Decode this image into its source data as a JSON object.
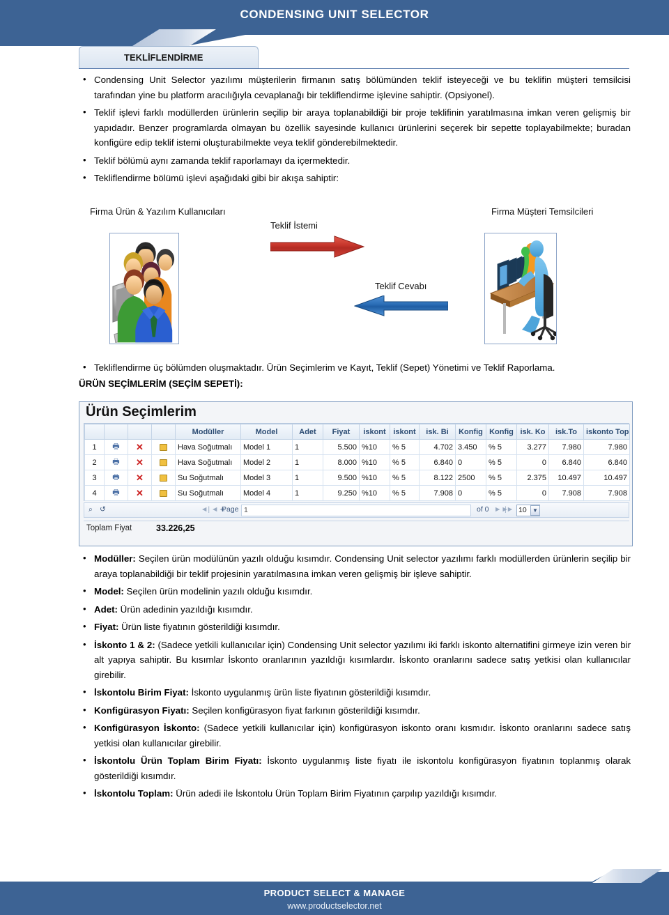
{
  "header": {
    "title": "CONDENSING UNIT SELECTOR"
  },
  "section_tab": {
    "label": "TEKLİFLENDİRME"
  },
  "intro_bullets": [
    "Condensing Unit Selector yazılımı müşterilerin firmanın satış bölümünden teklif isteyeceği ve bu teklifin müşteri temsilcisi tarafından yine bu platform aracılığıyla cevaplanağı bir  tekliflendirme işlevine sahiptir.  (Opsiyonel).",
    "Teklif işlevi farklı modüllerden ürünlerin seçilip bir araya toplanabildiği bir proje teklifinin yaratılmasına imkan veren gelişmiş bir yapıdadır. Benzer programlarda olmayan bu özellik sayesinde kullanıcı ürünlerini seçerek bir sepette toplayabilmekte; buradan konfigüre edip teklif istemi oluşturabilmekte veya teklif gönderebilmektedir.",
    "Teklif bölümü aynı zamanda teklif raporlamayı da içermektedir.",
    "Tekliflendirme bölümü işlevi aşağıdaki gibi bir akışa sahiptir:"
  ],
  "diagram": {
    "left_label": "Firma Ürün & Yazılım Kullanıcıları",
    "right_label": "Firma Müşteri Temsilcileri",
    "request_label": "Teklif İstemi",
    "response_label": "Teklif Cevabı",
    "request_color": "#c0392b",
    "response_color": "#2e74b5"
  },
  "mid_bullet": "Tekliflendirme üç bölümden oluşmaktadır.  Ürün Seçimlerim ve Kayıt, Teklif (Sepet) Yönetimi ve Teklif Raporlama.",
  "sub_heading": "ÜRÜN SEÇİMLERİM (SEÇİM SEPETİ):",
  "appshot": {
    "title": "Ürün Seçimlerim",
    "columns": [
      "",
      "",
      "",
      "",
      "Modüller",
      "Model",
      "Adet",
      "Fiyat",
      "iskont",
      "iskont",
      "isk. Bi",
      "Konfig",
      "Konfig",
      "isk. Ko",
      "isk.To",
      "iskonto Topl"
    ],
    "rows": [
      {
        "idx": "1",
        "print": "print-icon",
        "delete": "delete-icon",
        "edit": "edit-icon",
        "modul": "Hava Soğutmalı",
        "model": "Model 1",
        "adet": "1",
        "fiyat": "5.500",
        "isk1": "%10",
        "isk2": "% 5",
        "iskbirim": "4.702",
        "konfig_fiyat": "3.450",
        "konfig_isk": "% 5",
        "isk_konfig": "3.277",
        "isk_toplam_birim": "7.980",
        "iskonto_toplam": "7.980"
      },
      {
        "idx": "2",
        "print": "print-icon",
        "delete": "delete-icon",
        "edit": "edit-icon",
        "modul": "Hava Soğutmalı",
        "model": "Model 2",
        "adet": "1",
        "fiyat": "8.000",
        "isk1": "%10",
        "isk2": "% 5",
        "iskbirim": "6.840",
        "konfig_fiyat": "0",
        "konfig_isk": "% 5",
        "isk_konfig": "0",
        "isk_toplam_birim": "6.840",
        "iskonto_toplam": "6.840"
      },
      {
        "idx": "3",
        "print": "print-icon",
        "delete": "delete-icon",
        "edit": "edit-icon",
        "modul": "Su Soğutmalı",
        "model": "Model 3",
        "adet": "1",
        "fiyat": "9.500",
        "isk1": "%10",
        "isk2": "% 5",
        "iskbirim": "8.122",
        "konfig_fiyat": "2500",
        "konfig_isk": "% 5",
        "isk_konfig": "2.375",
        "isk_toplam_birim": "10.497",
        "iskonto_toplam": "10.497"
      },
      {
        "idx": "4",
        "print": "print-icon",
        "delete": "delete-icon",
        "edit": "edit-icon",
        "modul": "Su Soğutmalı",
        "model": "Model 4",
        "adet": "1",
        "fiyat": "9.250",
        "isk1": "%10",
        "isk2": "% 5",
        "iskbirim": "7.908",
        "konfig_fiyat": "0",
        "konfig_isk": "% 5",
        "isk_konfig": "0",
        "isk_toplam_birim": "7.908",
        "iskonto_toplam": "7.908"
      }
    ],
    "pager": {
      "page_label": "Page",
      "page_value": "1",
      "of_label": "of 0",
      "page_size": "10",
      "first_glyph": "◄|",
      "prev_glyph": "◄◄",
      "next_glyph": "►►",
      "last_glyph": "|►",
      "search_glyph": "⌕",
      "refresh_glyph": "↺",
      "dropdown_glyph": "▼"
    },
    "total_label": "Toplam Fiyat",
    "total_value": "33.226,25"
  },
  "definitions": [
    {
      "term": "Modüller:",
      "text": " Seçilen ürün modülünün yazılı olduğu kısımdır. Condensing Unit selector yazılımı farklı modüllerden ürünlerin seçilip bir araya toplanabildiği bir teklif projesinin yaratılmasına imkan veren gelişmiş bir işleve sahiptir."
    },
    {
      "term": "Model:",
      "text": " Seçilen ürün modelinin yazılı olduğu kısımdır."
    },
    {
      "term": "Adet:",
      "text": " Ürün adedinin yazıldığı kısımdır."
    },
    {
      "term": "Fiyat:",
      "text": " Ürün liste fiyatının gösterildiği kısımdır."
    },
    {
      "term": "İskonto 1 & 2:",
      "text": " (Sadece yetkili kullanıcılar için) Condensing Unit selector yazılımı iki farklı iskonto alternatifini girmeye izin veren bir alt yapıya sahiptir. Bu kısımlar İskonto oranlarının yazıldığı kısımlardır. İskonto oranlarını sadece satış yetkisi olan kullanıcılar girebilir."
    },
    {
      "term": "İskontolu Birim Fiyat:",
      "text": " İskonto uygulanmış ürün liste fiyatının gösterildiği kısımdır."
    },
    {
      "term": "Konfigürasyon Fiyatı:",
      "text": " Seçilen konfigürasyon fiyat farkının gösterildiği kısımdır."
    },
    {
      "term": "Konfigürasyon İskonto:",
      "text": " (Sadece yetkili kullanıcılar için) konfigürasyon iskonto oranı kısmıdır. İskonto oranlarını sadece satış yetkisi olan kullanıcılar girebilir."
    },
    {
      "term": "İskontolu Ürün Toplam Birim Fiyatı:",
      "text": " İskonto uygulanmış liste fiyatı ile iskontolu konfigürasyon fiyatının toplanmış olarak gösterildiği kısımdır."
    },
    {
      "term": "İskontolu Toplam:",
      "text": " Ürün adedi ile İskontolu Ürün Toplam Birim Fiyatının çarpılıp yazıldığı kısımdır."
    }
  ],
  "footer": {
    "line1": "PRODUCT SELECT & MANAGE",
    "line2": "www.productselector.net"
  },
  "colors": {
    "brand_blue": "#3d6394",
    "accent_red": "#c0392b",
    "accent_blue": "#2e74b5"
  }
}
